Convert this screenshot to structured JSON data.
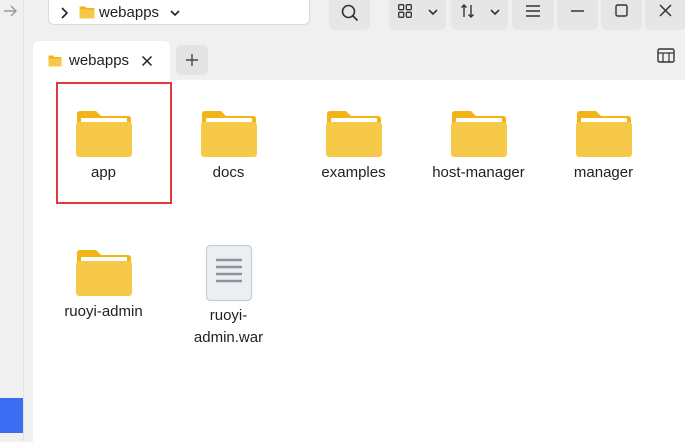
{
  "pathbar": {
    "crumb": "webapps"
  },
  "tab": {
    "label": "webapps"
  },
  "items": [
    {
      "label": "app",
      "type": "folder",
      "selected": true
    },
    {
      "label": "docs",
      "type": "folder"
    },
    {
      "label": "examples",
      "type": "folder"
    },
    {
      "label": "host-manager",
      "type": "folder"
    },
    {
      "label": "manager",
      "type": "folder"
    },
    {
      "label": "ruoyi-admin",
      "type": "folder"
    },
    {
      "label_line1": "ruoyi-",
      "label_line2": "admin.war",
      "type": "file"
    }
  ],
  "colors": {
    "folder_body": "#f7c948",
    "folder_back": "#f2b417",
    "selection_border": "#e0393e",
    "accent": "#3b6cf2"
  }
}
